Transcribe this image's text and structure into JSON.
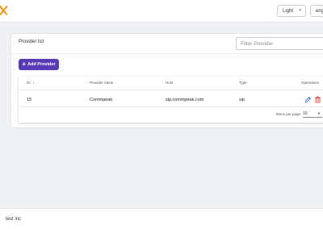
{
  "header": {
    "logo_icon": "brand-logo-icon",
    "brand_color": "#f39a1e",
    "theme_select": {
      "value": "Light",
      "icon": "chevron-down-icon"
    },
    "language_select": {
      "value": "eng"
    }
  },
  "provider_list": {
    "title": "Provider list",
    "filter_placeholder": "Filter Provider",
    "add_button": {
      "icon": "plus-icon",
      "label": "Add Provider",
      "color": "#5b3ab8"
    },
    "table": {
      "columns": [
        "ID",
        "Provider name",
        "Host",
        "Type",
        "Operations"
      ],
      "sort_icon": "arrow-down-icon",
      "rows": [
        {
          "id": "15",
          "name": "Commpeak",
          "host": "sip.commpeak.com",
          "type": "sip",
          "edit_icon": "edit-icon",
          "delete_icon": "delete-icon"
        }
      ],
      "items_per_page_label": "Items per page:",
      "items_per_page_value": "10",
      "edit_color": "#2f6fd8",
      "delete_color": "#e53935"
    }
  },
  "footer": {
    "text": "test inc"
  }
}
